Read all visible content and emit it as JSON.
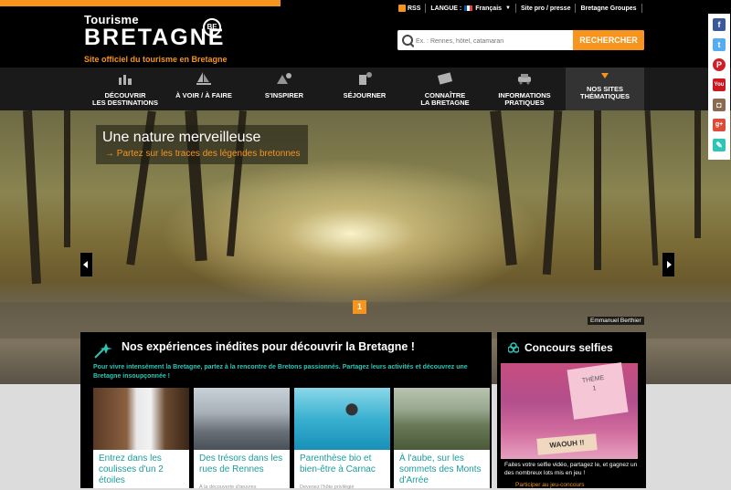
{
  "header": {
    "logo_line1": "Tourisme",
    "logo_line2": "BRETAGNE",
    "logo_badge": "BE",
    "tagline": "Site officiel du tourisme en Bretagne"
  },
  "utility_nav": {
    "rss": "RSS",
    "language_label": "LANGUE :",
    "language_value": "Français",
    "pro_link": "Site pro / presse",
    "groups_link": "Bretagne Groupes"
  },
  "search": {
    "placeholder": "Ex. : Rennes, hôtel, catamaran",
    "button": "RECHERCHER"
  },
  "nav": [
    {
      "line1": "DÉCOUVRIR",
      "line2": "LES DESTINATIONS"
    },
    {
      "line1": "",
      "line2": "À VOIR / À FAIRE"
    },
    {
      "line1": "",
      "line2": "S'INSPIRER"
    },
    {
      "line1": "",
      "line2": "SÉJOURNER"
    },
    {
      "line1": "CONNAÎTRE",
      "line2": "LA BRETAGNE"
    },
    {
      "line1": "INFORMATIONS",
      "line2": "PRATIQUES"
    },
    {
      "line1": "NOS SITES",
      "line2": "THÉMATIQUES"
    }
  ],
  "hero": {
    "title": "Une nature merveilleuse",
    "subtitle": "→ Partez sur les traces des légendes bretonnes",
    "page": "1",
    "credit": "Emmanuel Berthier"
  },
  "experiences": {
    "title": "Nos expériences inédites pour découvrir la Bretagne !",
    "intro": "Pour vivre intensément la Bretagne, partez à la rencontre de Bretons passionnés. Partagez leurs activités et découvrez une Bretagne insoupçonnée !",
    "cards": [
      {
        "title": "Entrez dans les coulisses d'un 2 étoiles",
        "sub": ""
      },
      {
        "title": "Des trésors dans les rues de Rennes",
        "sub": "À la découverte d'œuvres"
      },
      {
        "title": "Parenthèse bio et bien-être à Carnac",
        "sub": "Devenez l'hôte privilégié"
      },
      {
        "title": "À l'aube, sur les sommets des Monts d'Arrée",
        "sub": ""
      }
    ]
  },
  "concours": {
    "title": "Concours selfies",
    "paper_text": "THÈME 1",
    "badge": "WAOUH !!",
    "text": "Faites votre selfie vidéo, partagez le, et gagnez un des nombreux lots mis en jeu !",
    "link": "Participer au jeu-concours"
  },
  "social": [
    "facebook-icon",
    "twitter-icon",
    "pinterest-icon",
    "youtube-icon",
    "instagram-icon",
    "googleplus-icon",
    "blog-icon"
  ],
  "colors": {
    "accent": "#f7941d",
    "teal": "#2ec4b6",
    "bg": "#dcdcdc"
  }
}
